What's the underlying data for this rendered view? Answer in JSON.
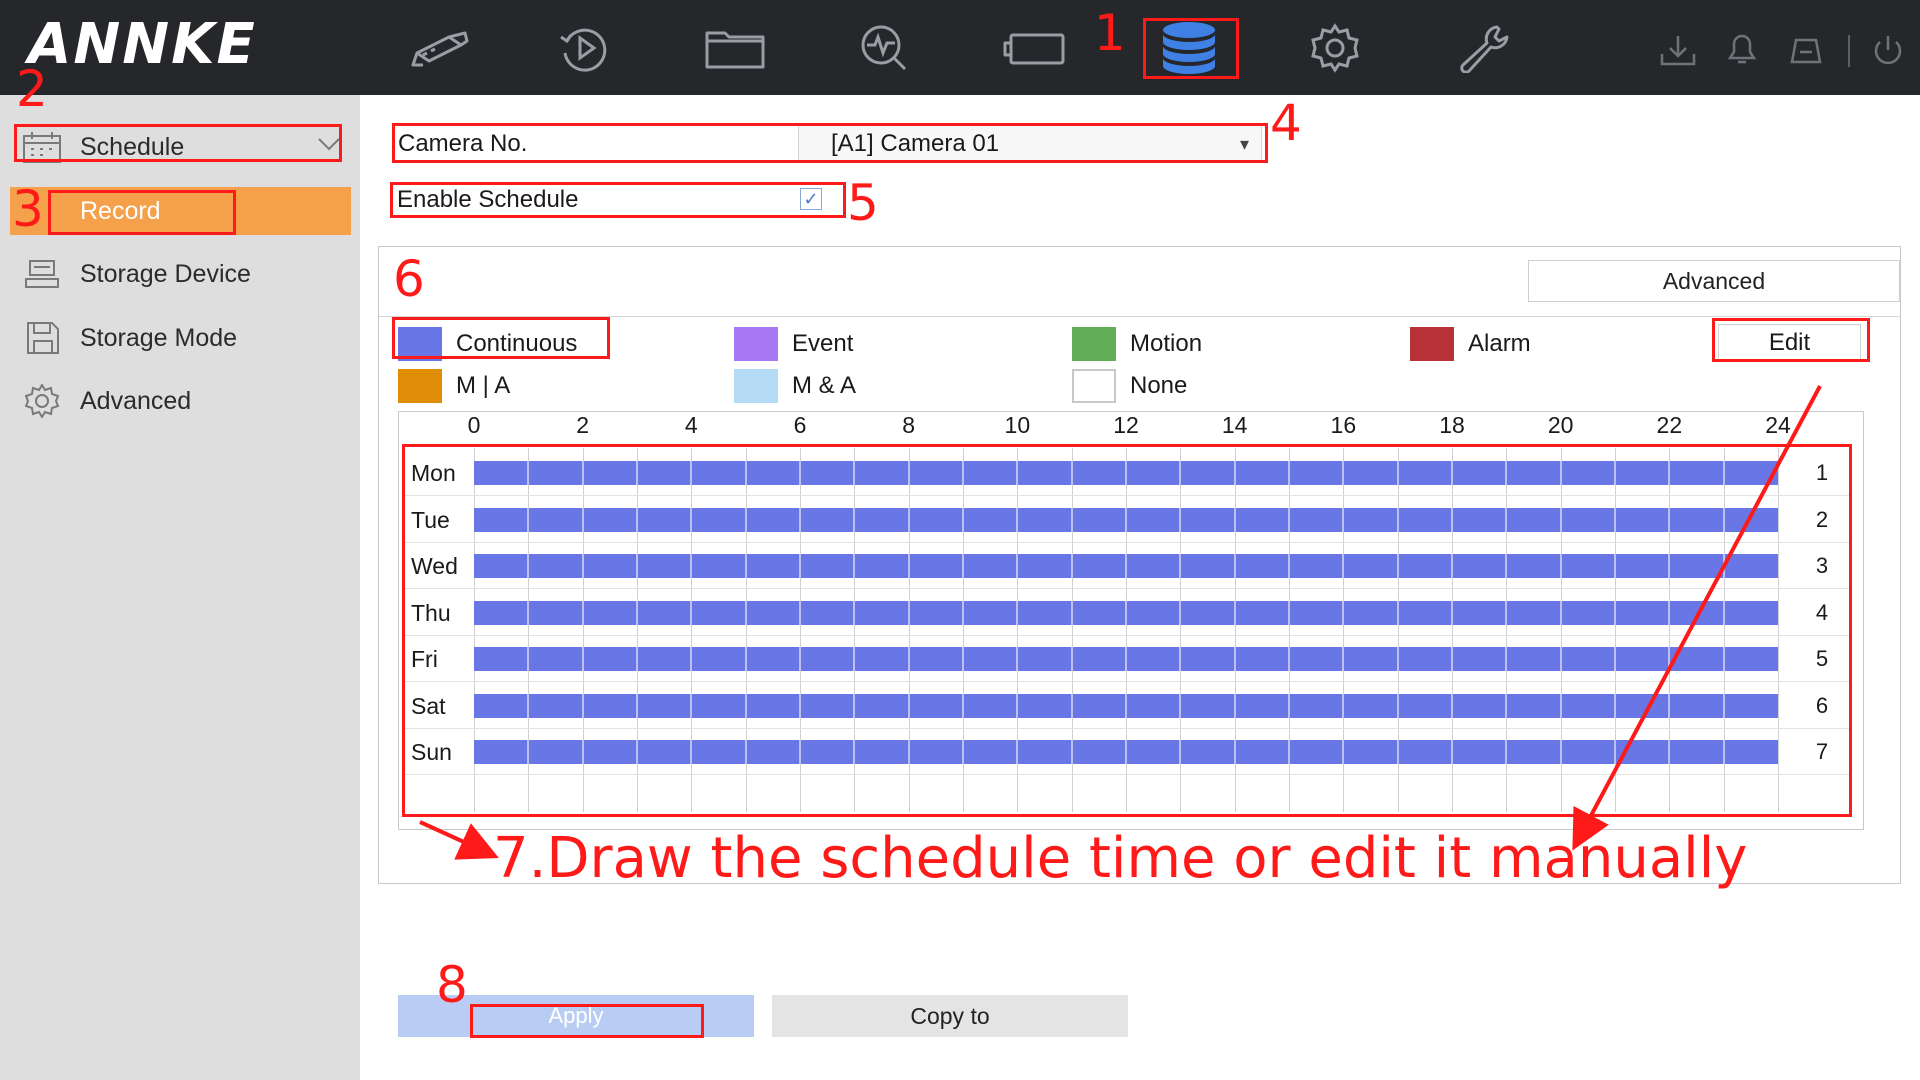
{
  "header": {
    "logo": "ANNKE",
    "nav_icons": [
      "live-view-camera-icon",
      "playback-icon",
      "file-management-icon",
      "search-analytics-icon",
      "camera-settings-icon",
      "storage-database-icon",
      "system-settings-icon",
      "maintenance-wrench-icon"
    ],
    "active_nav": "storage-database-icon",
    "right_icons": [
      "download-icon",
      "alarm-bell-icon",
      "alarm-output-icon",
      "power-icon"
    ]
  },
  "sidebar": {
    "items": [
      {
        "label": "Schedule",
        "icon": "calendar-icon"
      },
      {
        "label": "Record",
        "icon": ""
      },
      {
        "label": "Storage Device",
        "icon": "hard-drive-icon"
      },
      {
        "label": "Storage Mode",
        "icon": "floppy-disk-icon"
      },
      {
        "label": "Advanced",
        "icon": "gear-icon"
      }
    ]
  },
  "main": {
    "camera_label": "Camera No.",
    "camera_value": "[A1] Camera 01",
    "enable_schedule_label": "Enable Schedule",
    "enable_schedule_checked": true,
    "advanced_button": "Advanced",
    "edit_button": "Edit",
    "legend": [
      {
        "label": "Continuous",
        "color": "#6876e6"
      },
      {
        "label": "Event",
        "color": "#a877f3"
      },
      {
        "label": "Motion",
        "color": "#62ae58"
      },
      {
        "label": "Alarm",
        "color": "#b8323a"
      },
      {
        "label": "M | A",
        "color": "#df8c07"
      },
      {
        "label": "M & A",
        "color": "#b6dbf4"
      },
      {
        "label": "None",
        "color": "#ffffff"
      }
    ],
    "hours": [
      "0",
      "2",
      "4",
      "6",
      "8",
      "10",
      "12",
      "14",
      "16",
      "18",
      "20",
      "22",
      "24"
    ],
    "days": [
      {
        "label": "Mon",
        "num": "1",
        "type": "Continuous",
        "start": 0,
        "end": 24
      },
      {
        "label": "Tue",
        "num": "2",
        "type": "Continuous",
        "start": 0,
        "end": 24
      },
      {
        "label": "Wed",
        "num": "3",
        "type": "Continuous",
        "start": 0,
        "end": 24
      },
      {
        "label": "Thu",
        "num": "4",
        "type": "Continuous",
        "start": 0,
        "end": 24
      },
      {
        "label": "Fri",
        "num": "5",
        "type": "Continuous",
        "start": 0,
        "end": 24
      },
      {
        "label": "Sat",
        "num": "6",
        "type": "Continuous",
        "start": 0,
        "end": 24
      },
      {
        "label": "Sun",
        "num": "7",
        "type": "Continuous",
        "start": 0,
        "end": 24
      }
    ],
    "apply_button": "Apply",
    "copy_button": "Copy to"
  },
  "annotations": {
    "steps": [
      "1",
      "2",
      "3",
      "4",
      "5",
      "6",
      "8"
    ],
    "instruction": "7.Draw the schedule time or edit it manually",
    "color": "#ff1a1a"
  }
}
